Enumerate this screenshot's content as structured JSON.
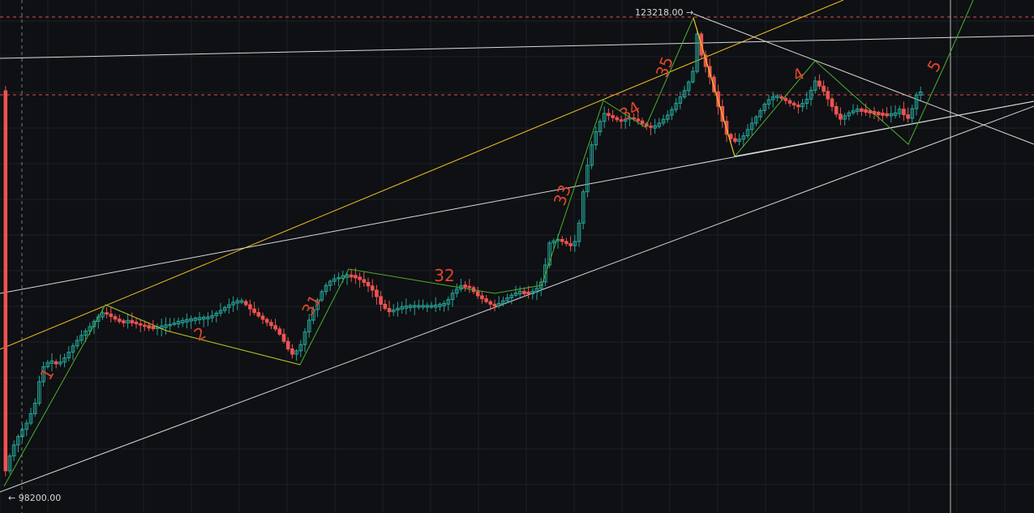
{
  "chart_data": {
    "type": "candlestick",
    "annotations": {
      "high_label": "123218.00 →",
      "low_label": "← 98200.00",
      "high_value": 123218.0,
      "low_value": 98200.0,
      "wave_labels": [
        "1",
        "2",
        "31",
        "32",
        "33",
        "34",
        "35",
        "4",
        "5"
      ]
    },
    "colors": {
      "background": "#0e1013",
      "grid": "#1c1f24",
      "up": "#26a69a",
      "down": "#ef5350",
      "trendline_white": "#d9d9d9",
      "trendline_yellow": "#f0c020",
      "wave_path": "#4caf2e",
      "wave_label": "#e0452b",
      "dashed_level": "#e05050",
      "dashed_crosshair": "#d8d8d8",
      "crosshair": "#d8d8d8"
    }
  }
}
